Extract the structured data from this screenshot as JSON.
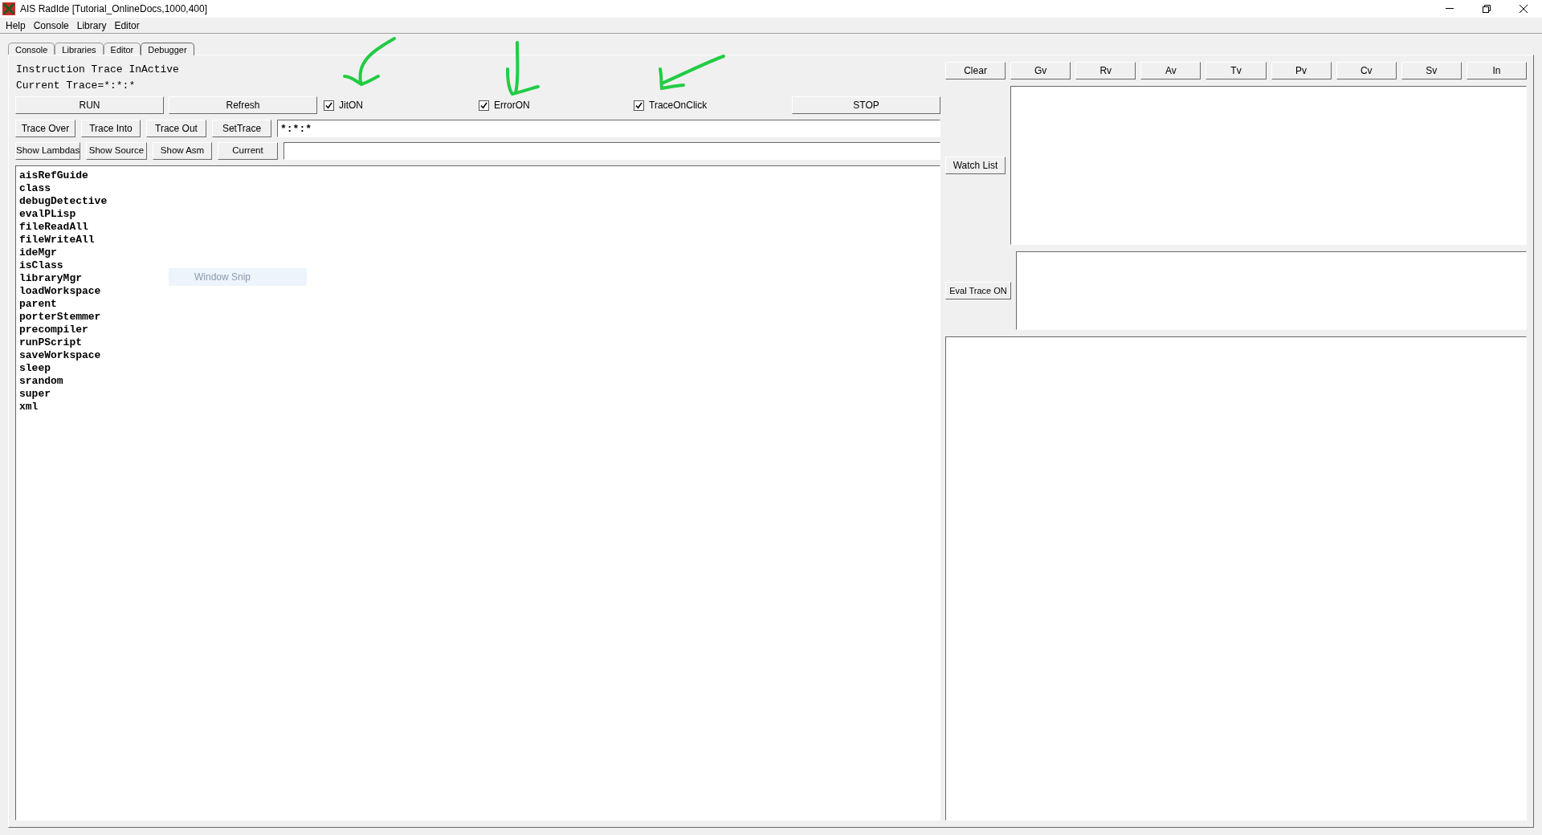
{
  "window": {
    "title": "AIS RadIde [Tutorial_OnlineDocs,1000,400]"
  },
  "menu": [
    "Help",
    "Console",
    "Library",
    "Editor"
  ],
  "tabs": [
    {
      "label": "Console",
      "selected": false
    },
    {
      "label": "Libraries",
      "selected": false
    },
    {
      "label": "Editor",
      "selected": false
    },
    {
      "label": "Debugger",
      "selected": true
    }
  ],
  "status_lines": [
    "Instruction Trace InActive",
    "Current Trace=*:*:*"
  ],
  "run_button": "RUN",
  "refresh_button": "Refresh",
  "checkboxes": [
    {
      "label": "JitON",
      "checked": true
    },
    {
      "label": "ErrorON",
      "checked": true
    },
    {
      "label": "TraceOnClick",
      "checked": true
    }
  ],
  "stop_button": "STOP",
  "trace_buttons": [
    "Trace Over",
    "Trace Into",
    "Trace Out",
    "SetTrace"
  ],
  "trace_field": {
    "value": "*:*:*"
  },
  "view_buttons": [
    "Show Lambdas",
    "Show Source",
    "Show Asm",
    "Current"
  ],
  "function_list": [
    "aisRefGuide",
    "class",
    "debugDetective",
    "evalPLisp",
    "fileReadAll",
    "fileWriteAll",
    "ideMgr",
    "isClass",
    "libraryMgr",
    "loadWorkspace",
    "parent",
    "porterStemmer",
    "precompiler",
    "runPScript",
    "saveWorkspace",
    "sleep",
    "srandom",
    "super",
    "xml"
  ],
  "tooltip": {
    "text": "Window Snip"
  },
  "variable_buttons": [
    "Clear",
    "Gv",
    "Rv",
    "Av",
    "Tv",
    "Pv",
    "Cv",
    "Sv",
    "In"
  ],
  "watch_list_button": "Watch List",
  "eval_trace_button": "Eval Trace ON"
}
